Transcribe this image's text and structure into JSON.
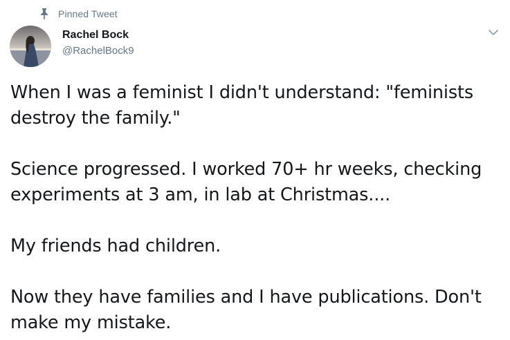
{
  "pinned": {
    "icon": "pin-icon",
    "label": "Pinned Tweet"
  },
  "author": {
    "avatar_icon": "avatar",
    "name": "Rachel Bock",
    "handle": "@RachelBock9"
  },
  "menu": {
    "icon": "chevron-down-icon"
  },
  "tweet": {
    "paragraphs": [
      "When I was a feminist I didn't understand: \"feminists destroy the family.\"",
      "Science progressed. I worked 70+ hr weeks, checking experiments at 3 am, in lab at Christmas....",
      "My friends had children.",
      "Now they have families and I have publications. Don't make my mistake."
    ]
  },
  "colors": {
    "text": "#14171a",
    "secondary": "#657786",
    "background": "#ffffff"
  }
}
